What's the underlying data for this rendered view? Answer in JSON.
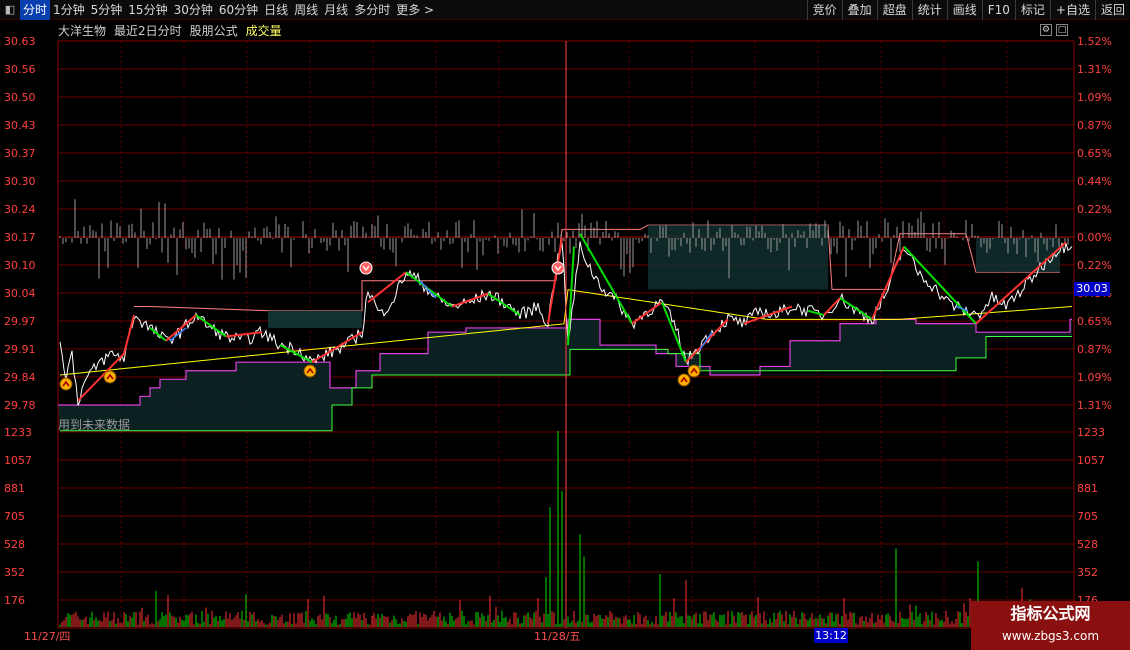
{
  "toolbar": {
    "left_buttons": [
      "分时",
      "1分钟",
      "5分钟",
      "15分钟",
      "30分钟",
      "60分钟",
      "日线",
      "周线",
      "月线",
      "多分时",
      "更多 >"
    ],
    "right_buttons": [
      "竞价",
      "叠加",
      "超盘",
      "统计",
      "画线",
      "F10",
      "标记",
      "+自选",
      "返回"
    ]
  },
  "header": {
    "stock_name": "大洋生物",
    "period": "最近2日分时",
    "formula": "股朋公式",
    "indicator": "成交量"
  },
  "note": "用到未来数据",
  "price_axis_labels": [
    "30.63",
    "30.56",
    "30.50",
    "30.43",
    "30.37",
    "30.30",
    "30.24",
    "30.17",
    "30.10",
    "30.04",
    "29.97",
    "29.91",
    "29.84",
    "29.78"
  ],
  "pct_axis_labels": [
    "1.52%",
    "1.31%",
    "1.09%",
    "0.87%",
    "0.65%",
    "0.44%",
    "0.22%",
    "0.00%",
    "0.22%",
    "0.43%",
    "0.65%",
    "0.87%",
    "1.09%",
    "1.31%"
  ],
  "volume_axis_labels": [
    "1233",
    "1057",
    "881",
    "705",
    "528",
    "352",
    "176"
  ],
  "current_price_tag": "30.03",
  "cursor_time": "13:12",
  "dates": [
    "11/27/四",
    "11/28/五"
  ],
  "watermark": {
    "line1": "指标公式网",
    "line2": "www.zbgs3.com"
  },
  "colors": {
    "up": "#ff3232",
    "down": "#00e000",
    "grid": "#8a0000",
    "price_line": "#ffffff",
    "avg_line": "#ffff00",
    "band_line": "#e040e0",
    "support_line": "#40ff40"
  },
  "chart_data": {
    "type": "line",
    "price_range": [
      29.72,
      30.63
    ],
    "base_price": 30.17,
    "volume_range": [
      0,
      1233
    ],
    "marks": {
      "buy": 4,
      "sell": 2
    }
  }
}
